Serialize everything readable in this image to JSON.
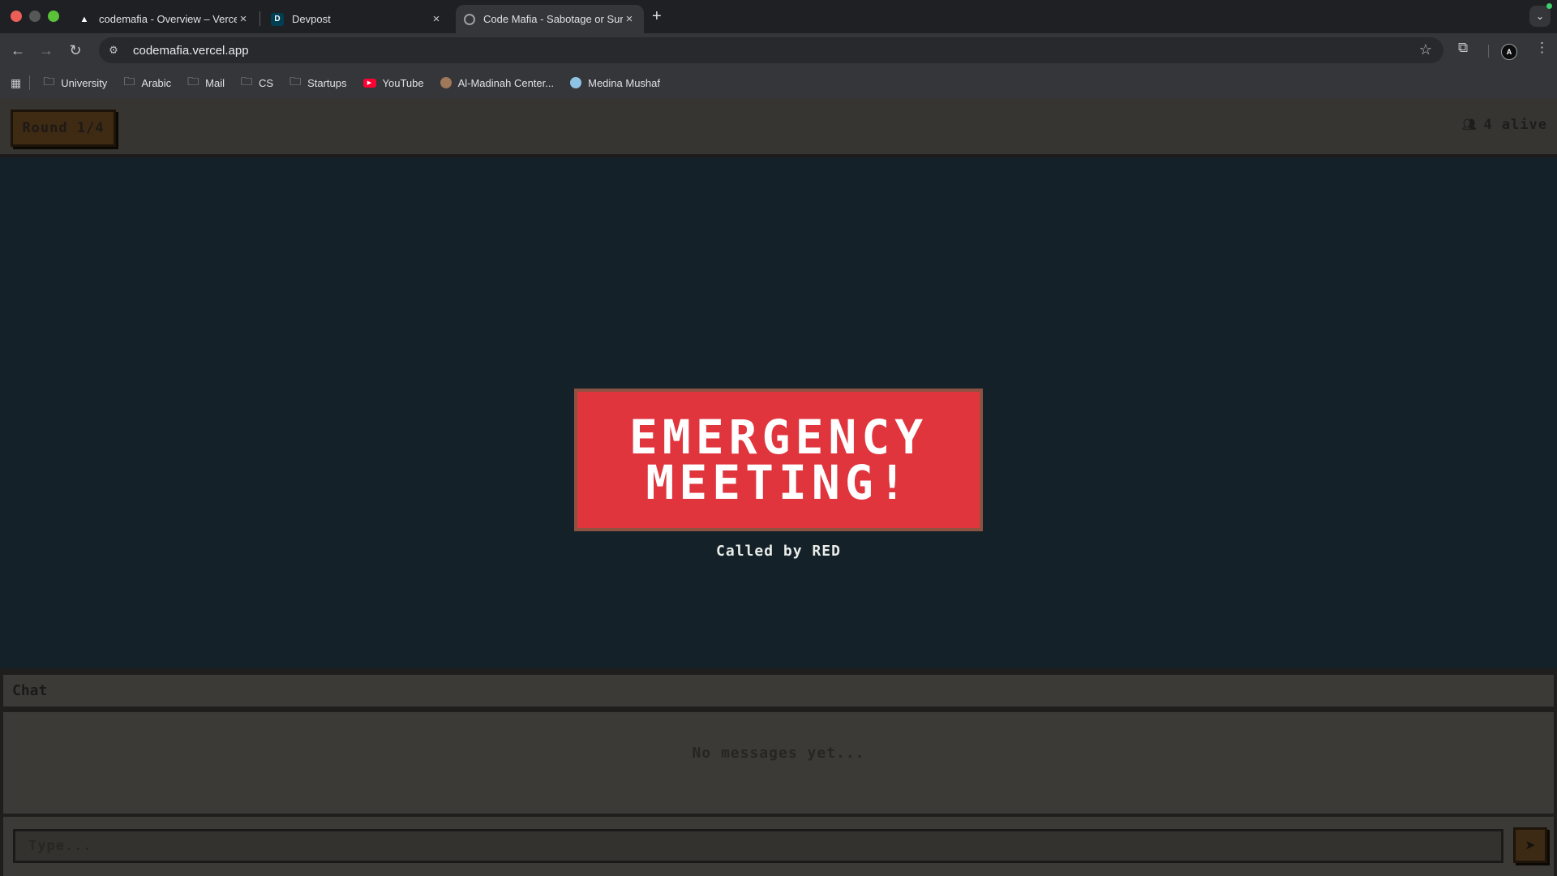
{
  "browser": {
    "tabs": [
      {
        "title": "codemafia - Overview – Vercel",
        "favicon": "vercel-icon"
      },
      {
        "title": "Devpost",
        "favicon": "devpost-icon",
        "favicon_letter": "D"
      },
      {
        "title": "Code Mafia - Sabotage or Survive",
        "favicon": "globe-icon",
        "active": true
      }
    ],
    "url": "codemafia.vercel.app",
    "profile_initial": "A",
    "bookmarks": [
      {
        "label": "University",
        "icon": "folder-icon"
      },
      {
        "label": "Arabic",
        "icon": "folder-icon"
      },
      {
        "label": "Mail",
        "icon": "folder-icon"
      },
      {
        "label": "CS",
        "icon": "folder-icon"
      },
      {
        "label": "Startups",
        "icon": "folder-icon"
      },
      {
        "label": "YouTube",
        "icon": "youtube-icon"
      },
      {
        "label": "Al-Madinah Center...",
        "icon": "site-icon"
      },
      {
        "label": "Medina Mushaf",
        "icon": "site-icon"
      }
    ]
  },
  "game": {
    "round_label": "Round 1/4",
    "alive_label": "4 alive",
    "emergency_line1": "EMERGENCY",
    "emergency_line2": "MEETING!",
    "called_by": "Called by RED"
  },
  "chat": {
    "title": "Chat",
    "empty_text": "No messages yet...",
    "input_placeholder": "Type..."
  },
  "colors": {
    "emergency": "#e0353d",
    "stage_bg": "#142129",
    "panel": "#3b3a37"
  }
}
